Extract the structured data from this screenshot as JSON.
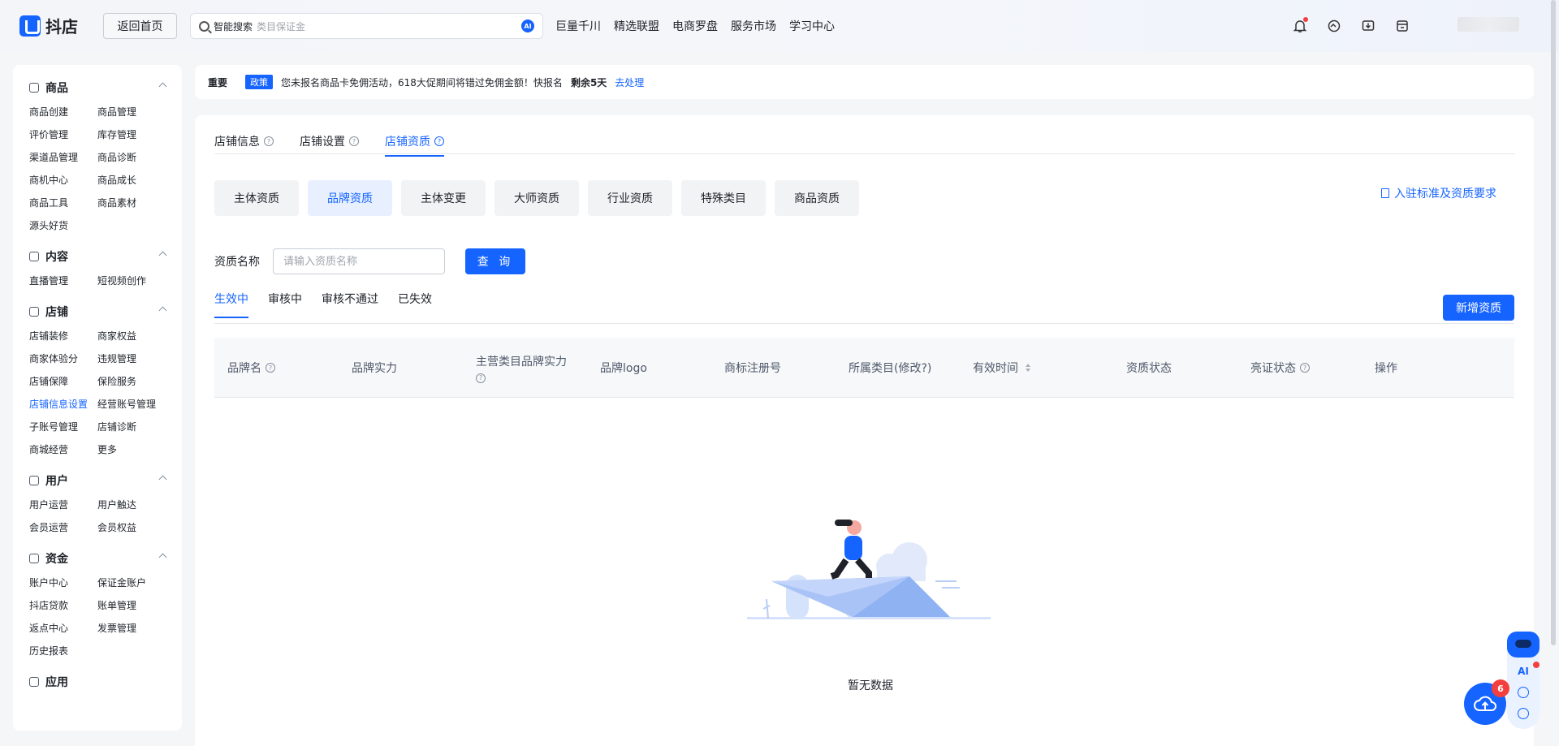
{
  "header": {
    "logo_text": "抖店",
    "home_button": "返回首页",
    "search": {
      "label": "智能搜索",
      "placeholder": "类目保证金",
      "ai_badge": "AI"
    },
    "nav": [
      "巨量千川",
      "精选联盟",
      "电商罗盘",
      "服务市场",
      "学习中心"
    ]
  },
  "sidebar": {
    "groups": [
      {
        "title": "商品",
        "items": [
          "商品创建",
          "商品管理",
          "评价管理",
          "库存管理",
          "渠道品管理",
          "商品诊断",
          "商机中心",
          "商品成长",
          "商品工具",
          "商品素材",
          "源头好货"
        ]
      },
      {
        "title": "内容",
        "items": [
          "直播管理",
          "短视频创作"
        ]
      },
      {
        "title": "店铺",
        "items": [
          "店铺装修",
          "商家权益",
          "商家体验分",
          "违规管理",
          "店铺保障",
          "保险服务",
          "店铺信息设置",
          "经营账号管理",
          "子账号管理",
          "店铺诊断",
          "商城经营",
          "更多"
        ],
        "active": "店铺信息设置"
      },
      {
        "title": "用户",
        "items": [
          "用户运营",
          "用户触达",
          "会员运营",
          "会员权益"
        ]
      },
      {
        "title": "资金",
        "items": [
          "账户中心",
          "保证金账户",
          "抖店贷款",
          "账单管理",
          "返点中心",
          "发票管理",
          "历史报表"
        ]
      },
      {
        "title": "应用",
        "items": []
      }
    ]
  },
  "notice": {
    "important": "重要",
    "tag": "政策",
    "text": "您未报名商品卡免佣活动，618大促期间将错过免佣金额！快报名",
    "remaining": "剩余5天",
    "action": "去处理"
  },
  "main": {
    "top_tabs": [
      "店铺信息",
      "店铺设置",
      "店铺资质"
    ],
    "active_top_tab": "店铺资质",
    "segments": [
      "主体资质",
      "品牌资质",
      "主体变更",
      "大师资质",
      "行业资质",
      "特殊类目",
      "商品资质"
    ],
    "active_segment": "品牌资质",
    "doc_link": "入驻标准及资质要求",
    "filter": {
      "label": "资质名称",
      "placeholder": "请输入资质名称",
      "query_button": "查 询"
    },
    "status_tabs": [
      "生效中",
      "审核中",
      "审核不通过",
      "已失效"
    ],
    "active_status_tab": "生效中",
    "add_button": "新增资质",
    "table_headers": [
      "品牌名",
      "品牌实力",
      "主营类目品牌实力",
      "品牌logo",
      "商标注册号",
      "所属类目(修改?)",
      "有效时间",
      "资质状态",
      "亮证状态",
      "操作"
    ],
    "empty_text": "暂无数据"
  },
  "floating": {
    "ai_label": "AI",
    "badge_count": "6"
  },
  "colors": {
    "primary": "#1664ff",
    "danger": "#f53f3f",
    "page_bg": "#f5f6f7"
  }
}
